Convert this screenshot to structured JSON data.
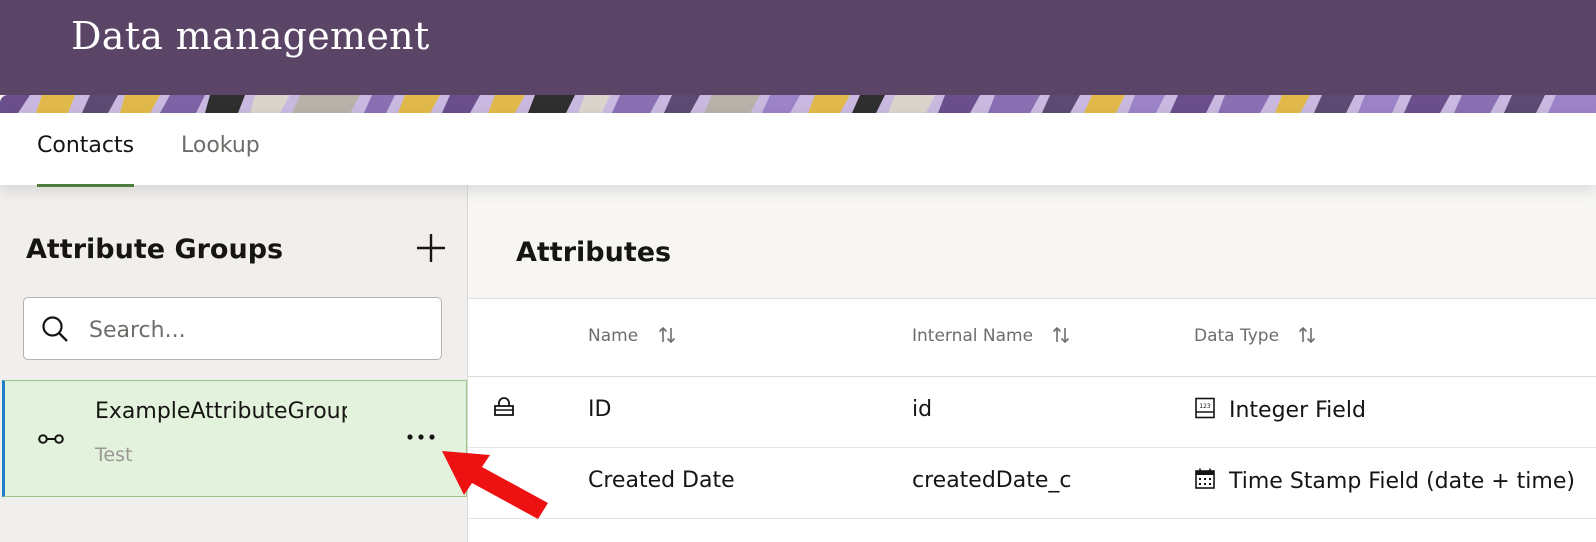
{
  "header": {
    "title": "Data management"
  },
  "tabs": [
    {
      "label": "Contacts",
      "active": true
    },
    {
      "label": "Lookup",
      "active": false
    }
  ],
  "left_panel": {
    "title": "Attribute Groups",
    "add_icon": "plus-icon",
    "search": {
      "placeholder": "Search...",
      "value": ""
    },
    "groups": [
      {
        "name": "ExampleAttributeGroup",
        "description": "Test",
        "icon": "key-icon",
        "selected": true
      }
    ]
  },
  "right_panel": {
    "title": "Attributes",
    "columns": [
      {
        "label": "Name"
      },
      {
        "label": "Internal Name"
      },
      {
        "label": "Data Type"
      }
    ],
    "rows": [
      {
        "locked": true,
        "name": "ID",
        "internal": "id",
        "type": "Integer Field",
        "type_icon": "integer-field-icon"
      },
      {
        "locked": false,
        "name": "Created Date",
        "internal": "createdDate_c",
        "type": "Time Stamp Field (date + time)",
        "type_icon": "calendar-icon"
      }
    ]
  },
  "colors": {
    "header_bg": "#5a4567",
    "selected_bg": "#e3f2dc",
    "active_tab_underline": "#4f7d3f",
    "selection_accent": "#227ec6",
    "annotation_arrow": "#ee1111"
  }
}
